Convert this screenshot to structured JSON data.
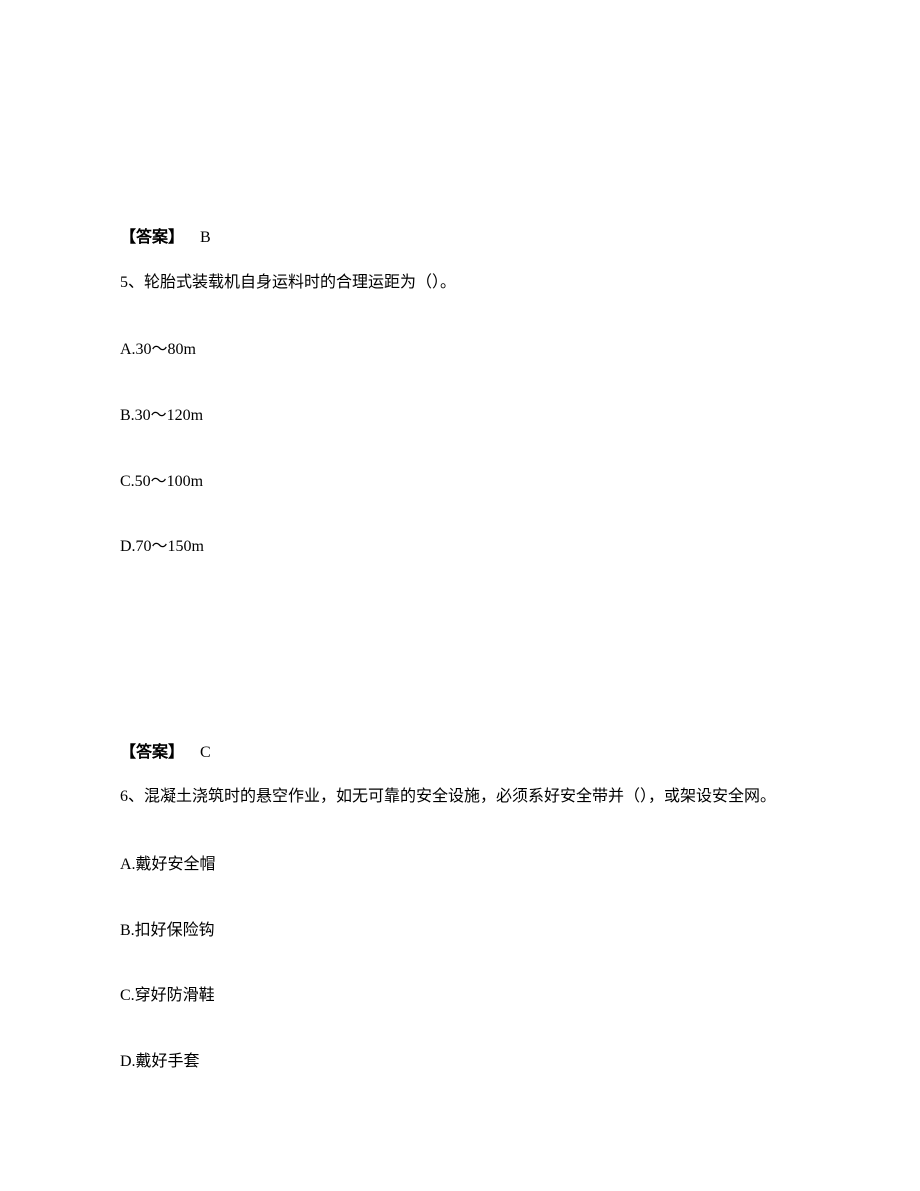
{
  "block1": {
    "answer_label": "【答案】",
    "answer_value": "B",
    "question": "5、轮胎式装载机自身运料时的合理运距为（）。",
    "options": {
      "a": "A.30～80m",
      "b": "B.30～120m",
      "c": "C.50～100m",
      "d": "D.70～150m"
    }
  },
  "block2": {
    "answer_label": "【答案】",
    "answer_value": "C",
    "question": "6、混凝土浇筑时的悬空作业，如无可靠的安全设施，必须系好安全带并（），或架设安全网。",
    "options": {
      "a": "A.戴好安全帽",
      "b": "B.扣好保险钩",
      "c": "C.穿好防滑鞋",
      "d": "D.戴好手套"
    }
  }
}
